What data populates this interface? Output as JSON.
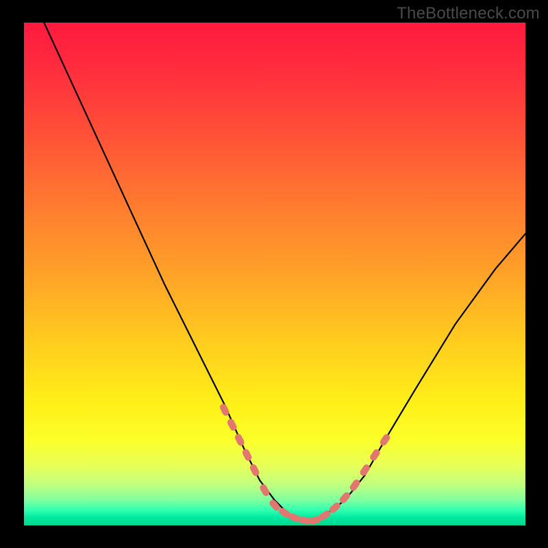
{
  "watermark": "TheBottleneck.com",
  "colors": {
    "background": "#000000",
    "curve": "#000000",
    "marker": "#e2776f",
    "gradient_stops": [
      "#ff1a3e",
      "#ff5037",
      "#ffa228",
      "#fff018",
      "#c0ff80",
      "#00d890"
    ]
  },
  "chart_data": {
    "type": "line",
    "title": "",
    "xlabel": "",
    "ylabel": "",
    "xlim": [
      0,
      100
    ],
    "ylim": [
      0,
      100
    ],
    "grid": false,
    "legend": false,
    "series": [
      {
        "name": "bottleneck-curve",
        "x": [
          4,
          10,
          16,
          22,
          28,
          34,
          40,
          44,
          47,
          50,
          53,
          56,
          58,
          60,
          64,
          68,
          72,
          78,
          86,
          94,
          100
        ],
        "y": [
          100,
          87,
          74,
          61,
          48,
          36,
          24,
          15,
          9,
          5,
          2,
          1,
          1,
          2,
          5,
          10,
          17,
          27,
          40,
          51,
          58
        ]
      }
    ],
    "markers": {
      "name": "highlighted-range",
      "x": [
        40,
        41.5,
        43,
        44.5,
        46,
        48,
        50,
        52,
        54,
        56,
        58,
        60,
        62,
        64,
        66,
        68,
        70,
        72
      ],
      "y": [
        23,
        20,
        17,
        14,
        11,
        7,
        4,
        2.5,
        1.5,
        1,
        1,
        2,
        3.5,
        5.5,
        8,
        11,
        14,
        17
      ]
    }
  }
}
